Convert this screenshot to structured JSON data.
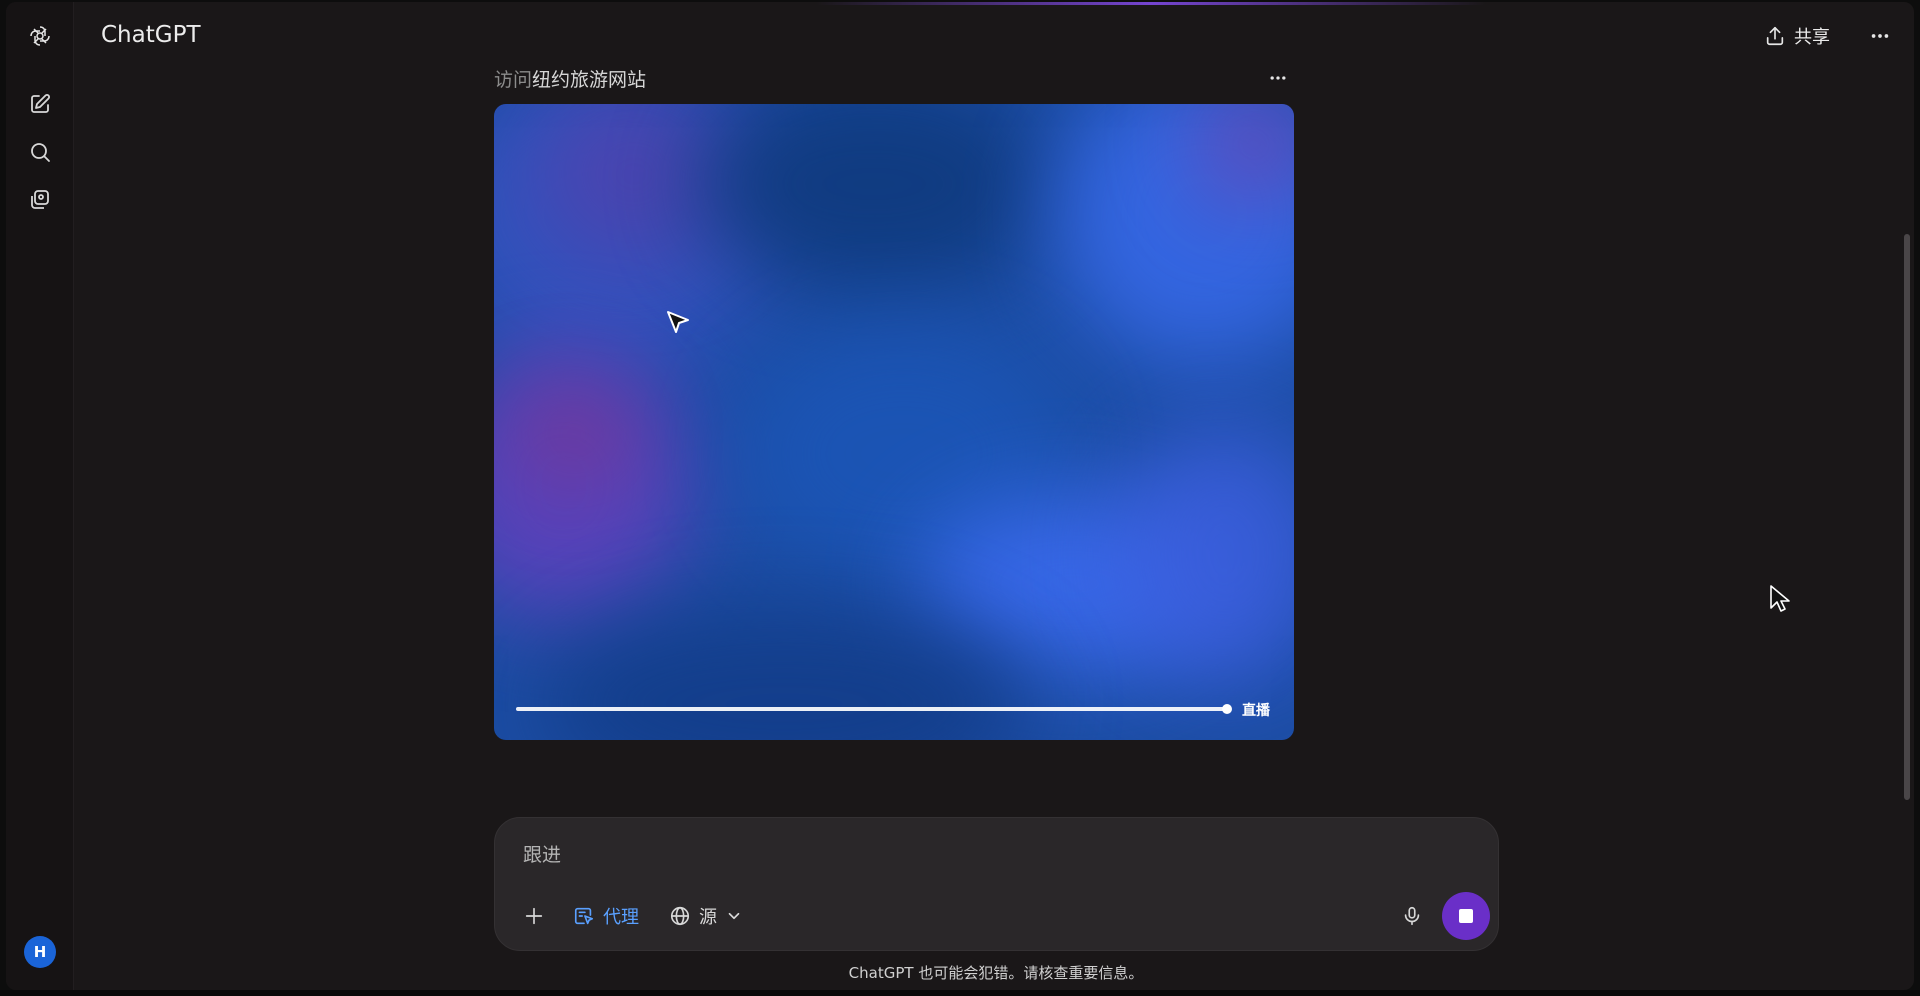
{
  "app": {
    "title": "ChatGPT"
  },
  "header": {
    "share_label": "共享"
  },
  "sidebar": {
    "avatar_initial": "H",
    "items": [
      {
        "icon": "new-chat-icon"
      },
      {
        "icon": "search-icon"
      },
      {
        "icon": "library-icon"
      }
    ]
  },
  "task": {
    "title_prefix": "访问",
    "title_rest": "纽约旅游网站"
  },
  "viewer": {
    "live_label": "直播",
    "progress": 1.0
  },
  "composer": {
    "placeholder": "跟进",
    "agent_label": "代理",
    "source_label": "源"
  },
  "footer": {
    "note": "ChatGPT 也可能会犯错。请核查重要信息。"
  },
  "colors": {
    "accent_purple": "#6a2fc8",
    "agent_blue": "#5aa0ff",
    "viewer_blue": "#1c4da4"
  }
}
